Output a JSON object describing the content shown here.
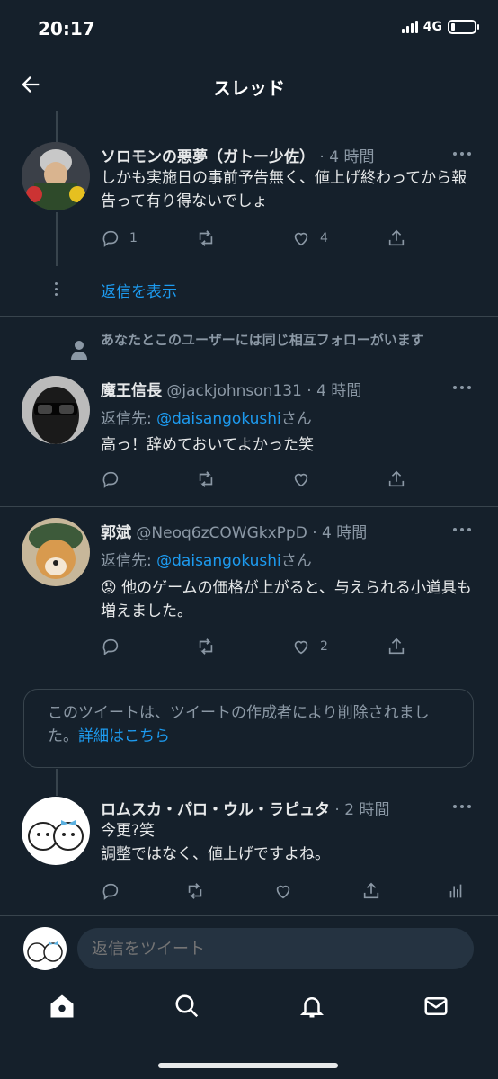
{
  "status": {
    "time": "20:17",
    "network": "4G"
  },
  "header": {
    "title": "スレッド"
  },
  "tweets": [
    {
      "name": "ソロモンの悪夢（ガトー少佐）",
      "handle": "",
      "time": "4 時間",
      "text": "しかも実施日の事前予告無く、値上げ終わってから報告って有り得ないでしょ",
      "reply_count": "1",
      "retweet_count": "",
      "like_count": "4"
    },
    {
      "name": "魔王信長",
      "handle": "@jackjohnson131",
      "time": "4 時間",
      "replying_prefix": "返信先: ",
      "replying_mention": "@daisangokushi",
      "replying_suffix": "さん",
      "text": "高っ！辞めておいてよかった笑",
      "reply_count": "",
      "retweet_count": "",
      "like_count": ""
    },
    {
      "name": "郭斌",
      "handle": "@Neoq6zCOWGkxPpD",
      "time": "4 時間",
      "replying_prefix": "返信先: ",
      "replying_mention": "@daisangokushi",
      "replying_suffix": "さん",
      "text": "😡 他のゲームの価格が上がると、与えられる小道具も増えました。",
      "reply_count": "",
      "retweet_count": "",
      "like_count": "2"
    },
    {
      "name": "ロムスカ・パロ・ウル・ラピュタ",
      "handle": "",
      "time": "2 時間",
      "text": "今更?笑\n調整ではなく、値上げですよね。",
      "reply_count": "",
      "retweet_count": "",
      "like_count": ""
    }
  ],
  "show_replies_label": "返信を表示",
  "social_context": "あなたとこのユーザーには同じ相互フォローがいます",
  "deleted": {
    "text": "このツイートは、ツイートの作成者により削除されました。",
    "link": "詳細はこちら"
  },
  "compose": {
    "placeholder": "返信をツイート"
  },
  "colors": {
    "background": "#15202b",
    "accent": "#1d9bf0",
    "muted": "#8b98a5",
    "border": "#38444d"
  }
}
